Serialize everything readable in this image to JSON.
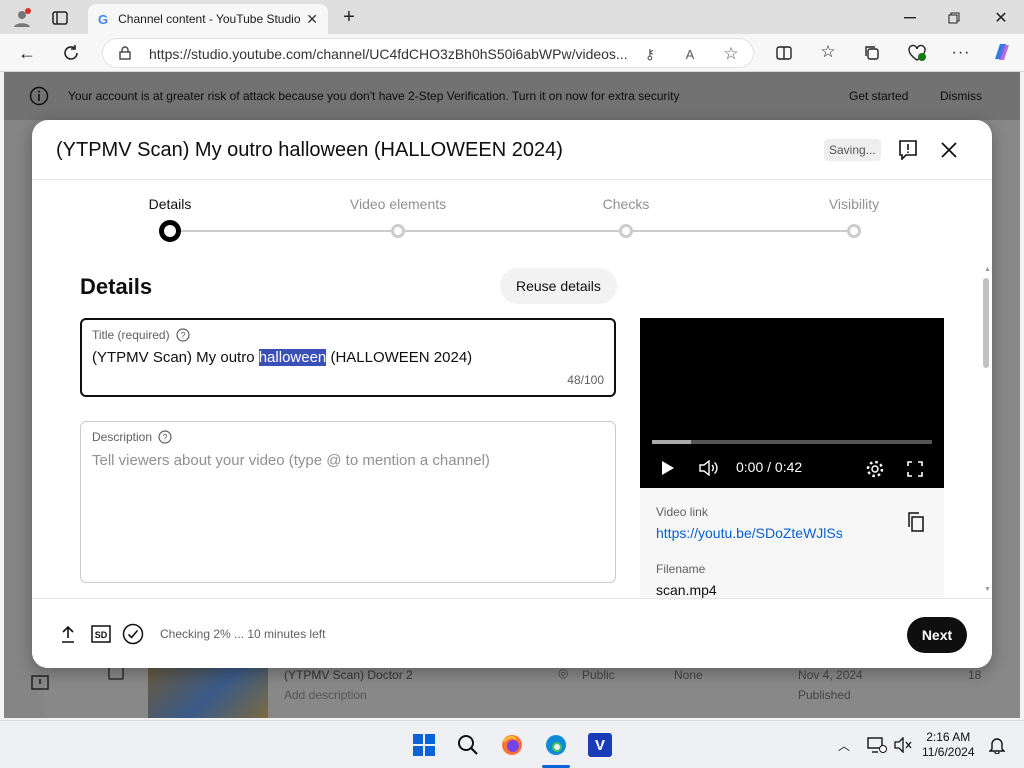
{
  "browser": {
    "tab_title": "Channel content - YouTube Studio",
    "url": "https://studio.youtube.com/channel/UC4fdCHO3zBh0hS50i6abWPw/videos..."
  },
  "banner": {
    "message": "Your account is at greater risk of attack because you don't have 2-Step Verification. Turn it on now for extra security",
    "get_started": "Get started",
    "dismiss": "Dismiss"
  },
  "background_row": {
    "title": "(YTPMV Scan) Doctor 2",
    "subtitle": "Add description",
    "visibility": "Public",
    "restrictions": "None",
    "date": "Nov 4, 2024",
    "status": "Published",
    "views": "18"
  },
  "modal": {
    "title": "(YTPMV Scan) My outro halloween (HALLOWEEN 2024)",
    "saving": "Saving...",
    "steps": [
      "Details",
      "Video elements",
      "Checks",
      "Visibility"
    ],
    "heading": "Details",
    "reuse_button": "Reuse details",
    "title_field": {
      "label": "Title (required)",
      "before": "(YTPMV Scan) My outro ",
      "selected": "halloween",
      "after": " (HALLOWEEN 2024)",
      "count": "48/100"
    },
    "description_field": {
      "label": "Description",
      "placeholder": "Tell viewers about your video (type @ to mention a channel)"
    },
    "video": {
      "time": "0:00 / 0:42",
      "progress": 0.14,
      "link_label": "Video link",
      "link": "https://youtu.be/SDoZteWJlSs",
      "filename_label": "Filename",
      "filename": "scan.mp4"
    },
    "footer": {
      "checking": "Checking 2% ... 10 minutes left",
      "next": "Next"
    }
  },
  "taskbar": {
    "time": "2:16 AM",
    "date": "11/6/2024"
  }
}
